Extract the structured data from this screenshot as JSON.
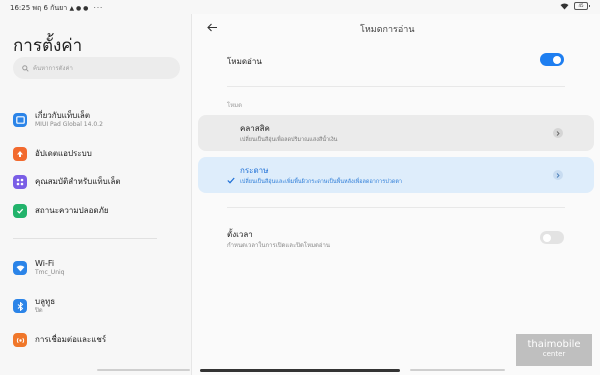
{
  "status_bar": {
    "left_text": "16:25 พฤ 6 กันยา",
    "dots": "···",
    "battery": "45"
  },
  "left_panel": {
    "title": "การตั้งค่า",
    "search_placeholder": "ค้นหาการตั้งค่า",
    "items": [
      {
        "label": "เกี่ยวกับแท็บเล็ต",
        "sub": "MIUI Pad Global 14.0.2",
        "icon": "tablet-icon",
        "color": "#2b84e8"
      },
      {
        "label": "อัปเดตแอประบบ",
        "sub": "",
        "icon": "update-arrow-icon",
        "color": "#f26a2e"
      },
      {
        "label": "คุณสมบัติสำหรับแท็บเล็ต",
        "sub": "",
        "icon": "grid-icon",
        "color": "#7a5ee6"
      },
      {
        "label": "สถานะความปลอดภัย",
        "sub": "",
        "icon": "shield-check-icon",
        "color": "#22b36b"
      },
      {
        "label": "Wi-Fi",
        "sub": "Tmc_Uniq",
        "icon": "wifi-icon",
        "color": "#2b84e8"
      },
      {
        "label": "บลูทูธ",
        "sub": "ปิด",
        "icon": "bluetooth-icon",
        "color": "#2b84e8"
      },
      {
        "label": "การเชื่อมต่อและแชร์",
        "sub": "",
        "icon": "connection-icon",
        "color": "#f0772a"
      }
    ]
  },
  "right_panel": {
    "title": "โหมดการอ่าน",
    "reading_mode_label": "โหมดอ่าน",
    "reading_mode_on": true,
    "section_label": "โหมด",
    "modes": [
      {
        "title": "คลาสสิค",
        "sub": "เปลี่ยนเป็นสีอุ่นเพื่อลดปริมาณแสงสีน้ำเงิน",
        "selected": false
      },
      {
        "title": "กระดาษ",
        "sub": "เปลี่ยนเป็นสีอุ่นและเพิ่มพื้นผิวกระดาษเป็นพื้นหลังเพื่อลดอาการปวดตา",
        "selected": true
      }
    ],
    "timer_label": "ตั้งเวลา",
    "timer_sub": "กำหนดเวลาในการเปิดและปิดโหมดอ่าน",
    "timer_on": false
  },
  "watermark": {
    "line1": "thaimobile",
    "line2": "center"
  },
  "colors": {
    "accent": "#1e7ef0",
    "selected_card": "#deedfb",
    "plain_card": "#ebebeb"
  }
}
